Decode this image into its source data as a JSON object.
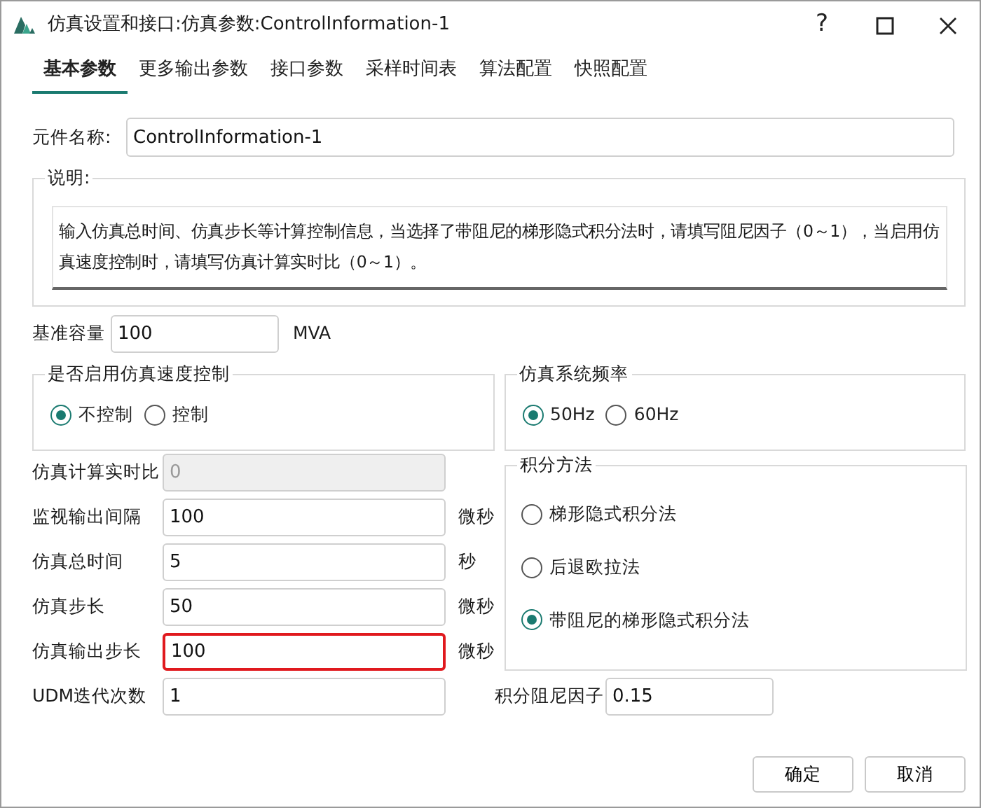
{
  "window": {
    "title": "仿真设置和接口:仿真参数:ControlInformation-1",
    "help": "?"
  },
  "tabs": [
    {
      "label": "基本参数",
      "selected": true
    },
    {
      "label": "更多输出参数",
      "selected": false
    },
    {
      "label": "接口参数",
      "selected": false
    },
    {
      "label": "采样时间表",
      "selected": false
    },
    {
      "label": "算法配置",
      "selected": false
    },
    {
      "label": "快照配置",
      "selected": false
    }
  ],
  "name_field": {
    "label": "元件名称:",
    "value": "ControlInformation-1"
  },
  "description": {
    "title": "说明:",
    "text": "输入仿真总时间、仿真步长等计算控制信息，当选择了带阻尼的梯形隐式积分法时，请填写阻尼因子（0～1），当启用仿真速度控制时，请填写仿真计算实时比（0～1）。"
  },
  "base_capacity": {
    "label": "基准容量",
    "value": "100",
    "unit": "MVA"
  },
  "speed_control": {
    "title": "是否启用仿真速度控制",
    "options": [
      {
        "label": "不控制",
        "selected": true
      },
      {
        "label": "控制",
        "selected": false
      }
    ]
  },
  "frequency": {
    "title": "仿真系统频率",
    "options": [
      {
        "label": "50Hz",
        "selected": true
      },
      {
        "label": "60Hz",
        "selected": false
      }
    ]
  },
  "fields": [
    {
      "label": "仿真计算实时比",
      "value": "0",
      "disabled": true,
      "error": false
    },
    {
      "label": "监视输出间隔",
      "value": "100",
      "unit": "微秒",
      "disabled": false,
      "error": false
    },
    {
      "label": "仿真总时间",
      "value": "5",
      "unit": "秒",
      "disabled": false,
      "error": false
    },
    {
      "label": "仿真步长",
      "value": "50",
      "unit": "微秒",
      "disabled": false,
      "error": false
    },
    {
      "label": "仿真输出步长",
      "value": "100",
      "unit": "微秒",
      "disabled": false,
      "error": true
    },
    {
      "label": "UDM迭代次数",
      "value": "1",
      "disabled": false,
      "error": false
    }
  ],
  "integration": {
    "title": "积分方法",
    "options": [
      {
        "label": "梯形隐式积分法",
        "selected": false
      },
      {
        "label": "后退欧拉法",
        "selected": false
      },
      {
        "label": "带阻尼的梯形隐式积分法",
        "selected": true
      }
    ]
  },
  "damping": {
    "label": "积分阻尼因子",
    "value": "0.15"
  },
  "buttons": [
    "确定",
    "取消"
  ]
}
